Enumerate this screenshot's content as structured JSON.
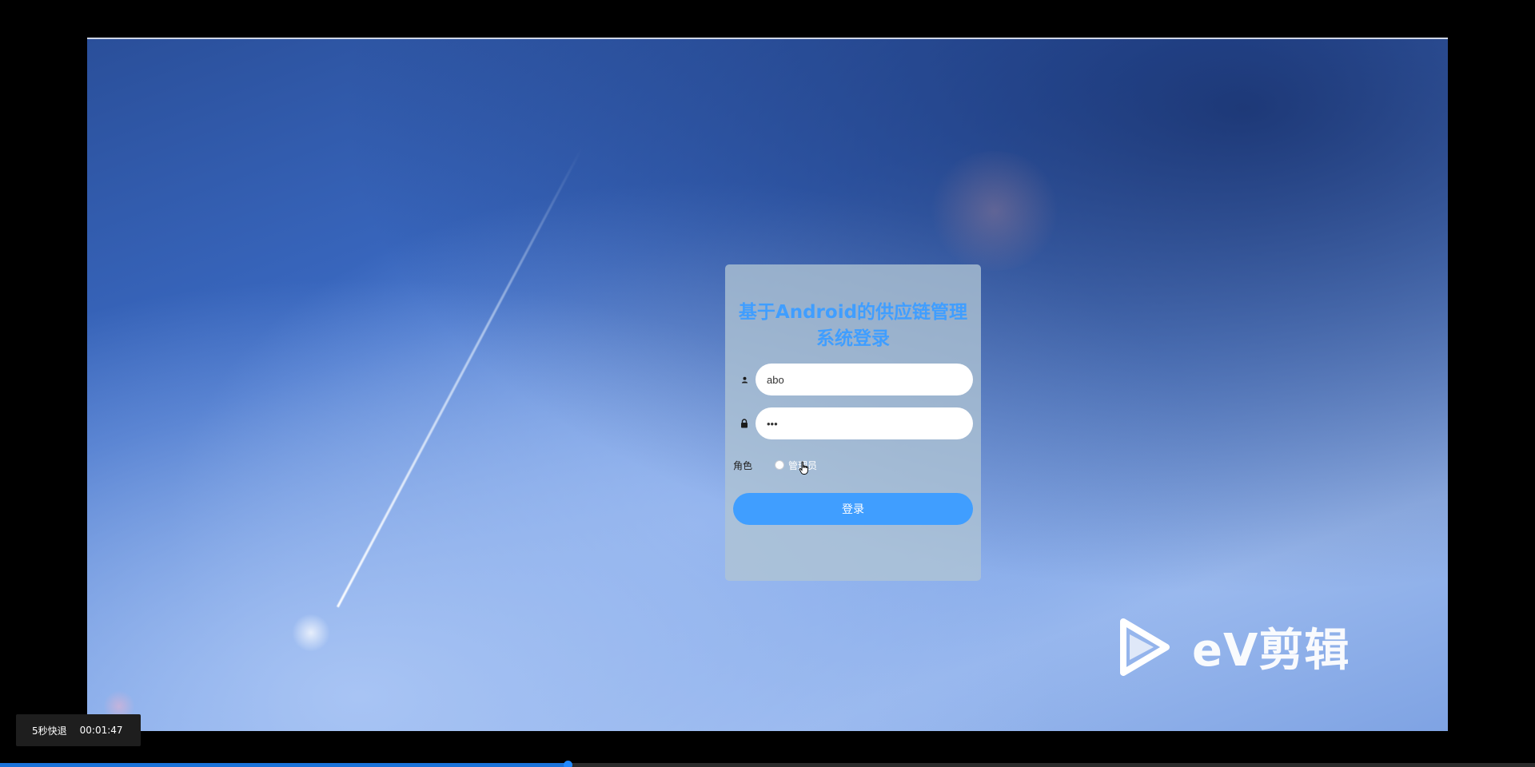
{
  "login": {
    "title": "基于Android的供应链管理系统登录",
    "username_value": "abo",
    "password_value": "•••",
    "role_label": "角色",
    "role_option": "管理员",
    "login_button": "登录"
  },
  "watermark": {
    "text": "eV剪辑"
  },
  "player": {
    "skip_label": "5秒快退",
    "time": "00:01:47",
    "progress_fraction": 0.37
  },
  "colors": {
    "accent": "#409eff",
    "progress": "#1a73d9"
  },
  "icons": {
    "username": "user-icon",
    "password": "lock-icon",
    "watermark": "play-logo-icon"
  }
}
